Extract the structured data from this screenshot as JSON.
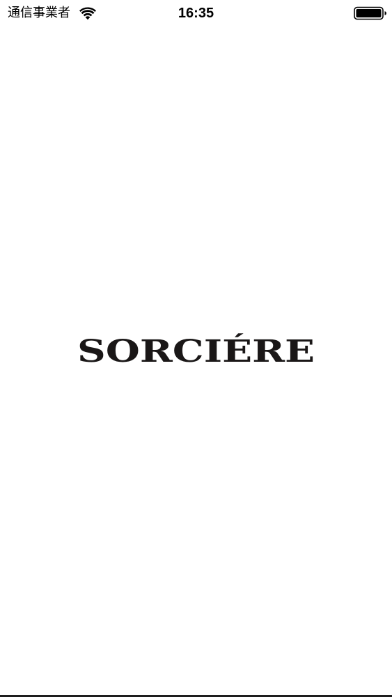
{
  "status_bar": {
    "carrier": "通信事業者",
    "time": "16:35",
    "wifi_icon": "wifi-icon",
    "battery_icon": "battery-icon",
    "battery_level": 1.0
  },
  "splash": {
    "logo_text": "SORCIÉRE",
    "logo_color": "#1a1717"
  },
  "colors": {
    "background": "#ffffff",
    "text": "#000000"
  }
}
